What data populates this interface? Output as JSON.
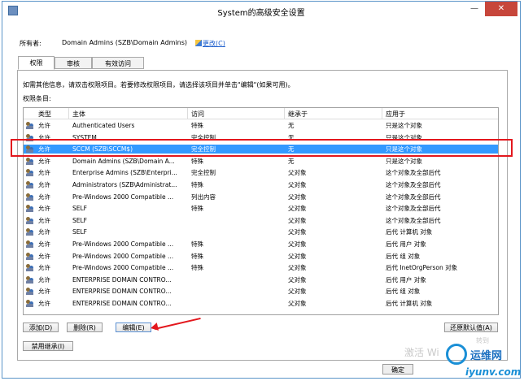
{
  "window": {
    "title": "System的高级安全设置",
    "close_glyph": "✕",
    "minimize_glyph": "—"
  },
  "owner": {
    "label": "所有者:",
    "value": "Domain Admins (SZB\\Domain Admins)",
    "change_link": "更改(C)"
  },
  "tabs": [
    {
      "label": "权限",
      "active": true
    },
    {
      "label": "审核",
      "active": false
    },
    {
      "label": "有效访问",
      "active": false
    }
  ],
  "hint": "如需其他信息，请双击权限项目。若要修改权限项目，请选择该项目并单击\"编辑\"(如果可用)。",
  "entries_label": "权限条目:",
  "columns": [
    "类型",
    "主体",
    "访问",
    "继承于",
    "应用于"
  ],
  "rows": [
    {
      "type": "允许",
      "principal": "Authenticated Users",
      "access": "特殊",
      "inherited": "无",
      "applies": "只是这个对象",
      "selected": false
    },
    {
      "type": "允许",
      "principal": "SYSTEM",
      "access": "完全控制",
      "inherited": "无",
      "applies": "只是这个对象",
      "selected": false
    },
    {
      "type": "允许",
      "principal": "SCCM (SZB\\SCCM$)",
      "access": "完全控制",
      "inherited": "无",
      "applies": "只是这个对象",
      "selected": true
    },
    {
      "type": "允许",
      "principal": "Domain Admins (SZB\\Domain A...",
      "access": "特殊",
      "inherited": "无",
      "applies": "只是这个对象",
      "selected": false
    },
    {
      "type": "允许",
      "principal": "Enterprise Admins (SZB\\Enterpri...",
      "access": "完全控制",
      "inherited": "父对象",
      "applies": "这个对象及全部后代",
      "selected": false
    },
    {
      "type": "允许",
      "principal": "Administrators (SZB\\Administrat...",
      "access": "特殊",
      "inherited": "父对象",
      "applies": "这个对象及全部后代",
      "selected": false
    },
    {
      "type": "允许",
      "principal": "Pre-Windows 2000 Compatible ...",
      "access": "列出内容",
      "inherited": "父对象",
      "applies": "这个对象及全部后代",
      "selected": false
    },
    {
      "type": "允许",
      "principal": "SELF",
      "access": "特殊",
      "inherited": "父对象",
      "applies": "这个对象及全部后代",
      "selected": false
    },
    {
      "type": "允许",
      "principal": "SELF",
      "access": "",
      "inherited": "父对象",
      "applies": "这个对象及全部后代",
      "selected": false
    },
    {
      "type": "允许",
      "principal": "SELF",
      "access": "",
      "inherited": "父对象",
      "applies": "后代 计算机 对象",
      "selected": false
    },
    {
      "type": "允许",
      "principal": "Pre-Windows 2000 Compatible ...",
      "access": "特殊",
      "inherited": "父对象",
      "applies": "后代 用户 对象",
      "selected": false
    },
    {
      "type": "允许",
      "principal": "Pre-Windows 2000 Compatible ...",
      "access": "特殊",
      "inherited": "父对象",
      "applies": "后代 组 对象",
      "selected": false
    },
    {
      "type": "允许",
      "principal": "Pre-Windows 2000 Compatible ...",
      "access": "特殊",
      "inherited": "父对象",
      "applies": "后代 InetOrgPerson 对象",
      "selected": false
    },
    {
      "type": "允许",
      "principal": "ENTERPRISE DOMAIN CONTRO...",
      "access": "",
      "inherited": "父对象",
      "applies": "后代 用户 对象",
      "selected": false
    },
    {
      "type": "允许",
      "principal": "ENTERPRISE DOMAIN CONTRO...",
      "access": "",
      "inherited": "父对象",
      "applies": "后代 组 对象",
      "selected": false
    },
    {
      "type": "允许",
      "principal": "ENTERPRISE DOMAIN CONTRO...",
      "access": "",
      "inherited": "父对象",
      "applies": "后代 计算机 对象",
      "selected": false
    }
  ],
  "buttons": {
    "add": "添加(D)",
    "remove": "删除(R)",
    "edit": "编辑(E)",
    "restore_defaults": "还原默认值(A)",
    "disable_inheritance": "禁用继承(I)",
    "ok": "确定"
  },
  "watermark": {
    "activate": "激活 Wi",
    "settings": "转到"
  },
  "logo": {
    "name": "运维网",
    "domain": "iyunv.com"
  },
  "colors": {
    "selection": "#3399ff",
    "annotation": "#e3171d",
    "link": "#1a5ccc"
  }
}
